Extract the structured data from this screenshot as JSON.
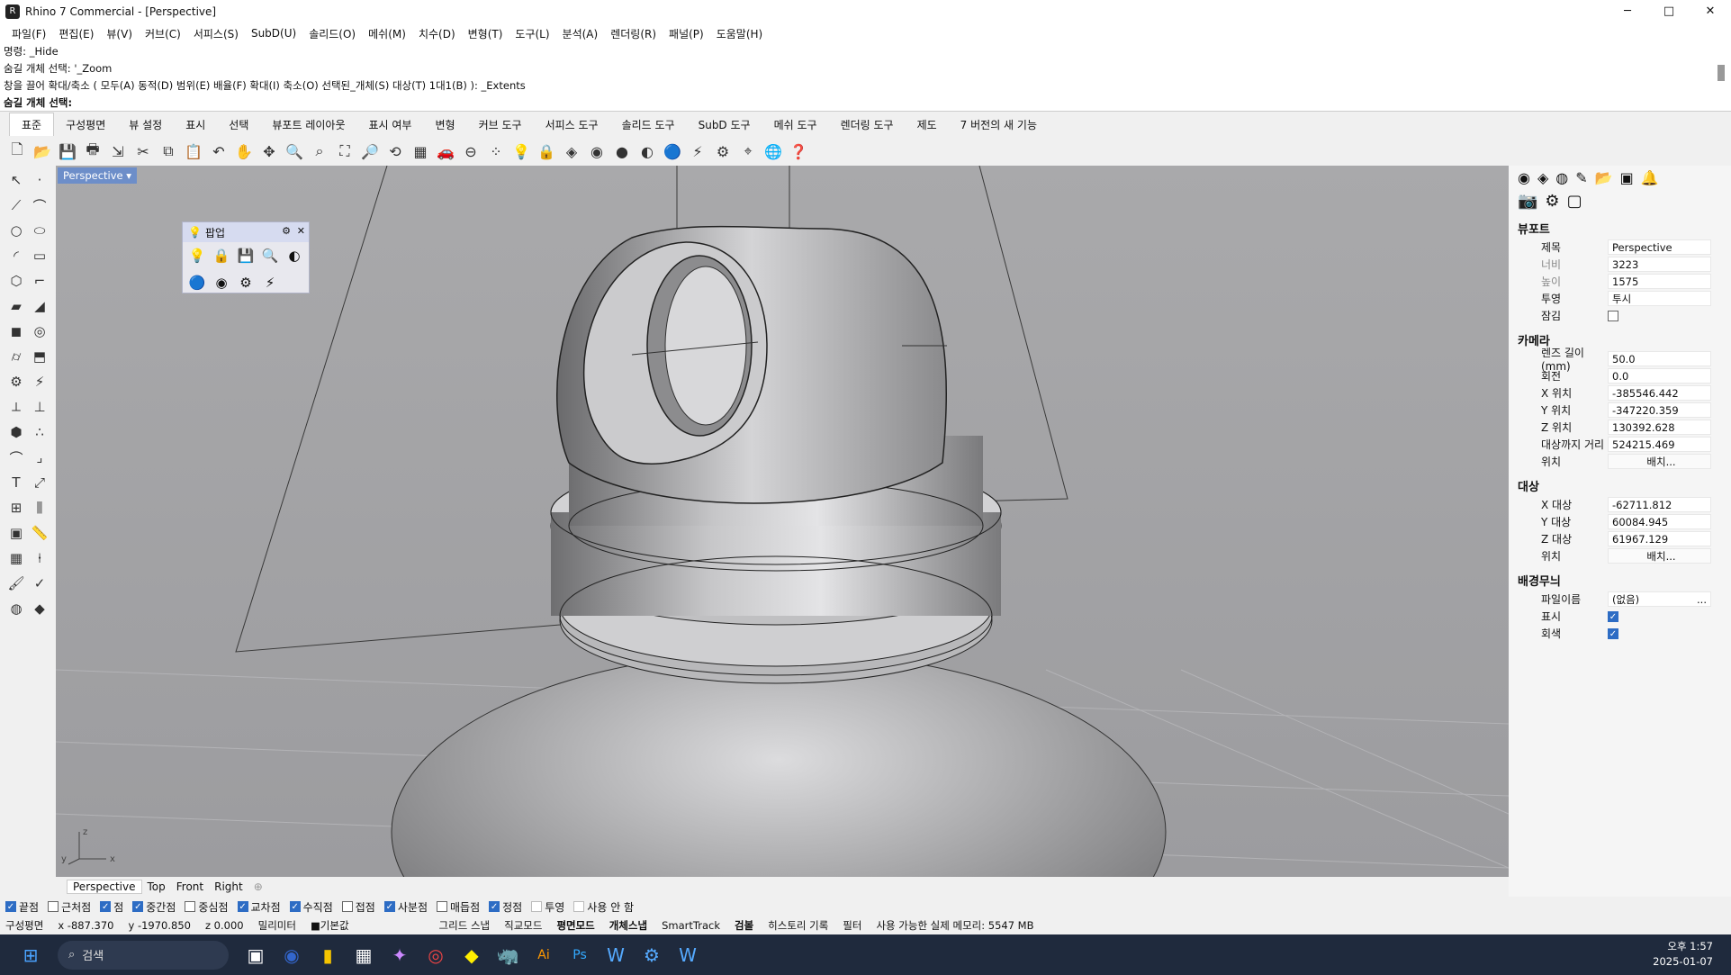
{
  "window": {
    "title": "Rhino 7 Commercial - [Perspective]",
    "minimize": "─",
    "maximize": "□",
    "close": "✕"
  },
  "menu": [
    "파일(F)",
    "편집(E)",
    "뷰(V)",
    "커브(C)",
    "서피스(S)",
    "SubD(U)",
    "솔리드(O)",
    "메쉬(M)",
    "치수(D)",
    "변형(T)",
    "도구(L)",
    "분석(A)",
    "렌더링(R)",
    "패널(P)",
    "도움말(H)"
  ],
  "command_history": [
    "명령: _Hide",
    "숨길 개체 선택: '_Zoom",
    "창을 끌어 확대/축소 ( 모두(A)  동적(D)  범위(E)  배율(F)  확대(I)  축소(O)  선택된_개체(S)  대상(T)  1대1(B) ): _Extents"
  ],
  "command_prompt": "숨길 개체 선택:",
  "toolbar_tabs": [
    "표준",
    "구성평면",
    "뷰 설정",
    "표시",
    "선택",
    "뷰포트 레이아웃",
    "표시 여부",
    "변형",
    "커브 도구",
    "서피스 도구",
    "솔리드 도구",
    "SubD 도구",
    "메쉬 도구",
    "렌더링 도구",
    "제도",
    "7 버전의 새 기능"
  ],
  "active_tab": "표준",
  "viewport": {
    "label": "Perspective",
    "dropdown": "▾",
    "axes": {
      "z": "z",
      "y": "y",
      "x": "x"
    }
  },
  "popup": {
    "title": "팝업",
    "gear": "⚙",
    "close": "✕"
  },
  "viewport_tabs": [
    "Perspective",
    "Top",
    "Front",
    "Right"
  ],
  "add_tab": "⊕",
  "properties": {
    "viewport_section": "뷰포트",
    "title_label": "제목",
    "title_value": "Perspective",
    "width_label": "너비",
    "width_value": "3223",
    "height_label": "높이",
    "height_value": "1575",
    "projection_label": "투영",
    "projection_value": "투시",
    "lock_label": "잠김",
    "camera_section": "카메라",
    "lens_label": "렌즈 길이(mm)",
    "lens_value": "50.0",
    "rotation_label": "회전",
    "rotation_value": "0.0",
    "xpos_label": "X 위치",
    "xpos_value": "-385546.442",
    "ypos_label": "Y 위치",
    "ypos_value": "-347220.359",
    "zpos_label": "Z 위치",
    "zpos_value": "130392.628",
    "dist_label": "대상까지 거리",
    "dist_value": "524215.469",
    "place_label": "위치",
    "place_button": "배치...",
    "target_section": "대상",
    "xt_label": "X 대상",
    "xt_value": "-62711.812",
    "yt_label": "Y 대상",
    "yt_value": "60084.945",
    "zt_label": "Z 대상",
    "zt_value": "61967.129",
    "tplace_label": "위치",
    "tplace_button": "배치...",
    "wallpaper_section": "배경무늬",
    "filename_label": "파일이름",
    "filename_value": "(없음)",
    "filename_more": "...",
    "show_label": "표시",
    "gray_label": "회색"
  },
  "osnaps": [
    {
      "label": "끝점",
      "on": true
    },
    {
      "label": "근처점",
      "on": false
    },
    {
      "label": "점",
      "on": true
    },
    {
      "label": "중간점",
      "on": true
    },
    {
      "label": "중심점",
      "on": false
    },
    {
      "label": "교차점",
      "on": true
    },
    {
      "label": "수직점",
      "on": true
    },
    {
      "label": "접점",
      "on": false
    },
    {
      "label": "사분점",
      "on": true
    },
    {
      "label": "매듭점",
      "on": false
    },
    {
      "label": "정점",
      "on": true
    },
    {
      "label": "투영",
      "on": false
    },
    {
      "label": "사용 안 함",
      "on": false
    }
  ],
  "status": {
    "cplane": "구성평면",
    "x": "x -887.370",
    "y": "y -1970.850",
    "z": "z 0.000",
    "units": "밀리미터",
    "layer": "■기본값",
    "grid_snap": "그리드 스냅",
    "ortho": "직교모드",
    "planar": "평면모드",
    "osnap": "개체스냅",
    "smarttrack": "SmartTrack",
    "gumball": "검볼",
    "history": "히스토리 기록",
    "filter": "필터",
    "memory": "사용 가능한 실제 메모리: 5547 MB"
  },
  "taskbar": {
    "search": "검색",
    "time": "오후 1:57",
    "date": "2025-01-07"
  },
  "colors": {
    "viewport_bg": "#a6a6a8",
    "vp_label": "#6d8ec9",
    "accent": "#2d6cc4"
  }
}
